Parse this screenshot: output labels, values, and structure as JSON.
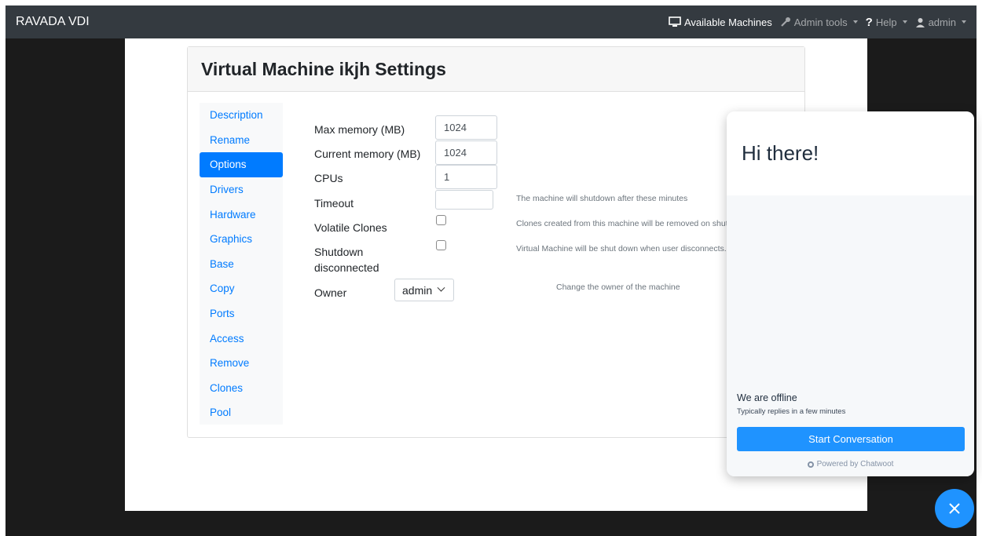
{
  "navbar": {
    "brand": "RAVADA VDI",
    "available_machines": "Available Machines",
    "admin_tools": "Admin tools",
    "help": "Help",
    "user": "admin"
  },
  "card": {
    "title_prefix": "Virtual Machine",
    "vm_name": "ikjh",
    "title_suffix": "Settings"
  },
  "sidebar": {
    "items": [
      {
        "label": "Description"
      },
      {
        "label": "Rename"
      },
      {
        "label": "Options"
      },
      {
        "label": "Drivers"
      },
      {
        "label": "Hardware"
      },
      {
        "label": "Graphics"
      },
      {
        "label": "Base"
      },
      {
        "label": "Copy"
      },
      {
        "label": "Ports"
      },
      {
        "label": "Access"
      },
      {
        "label": "Remove"
      },
      {
        "label": "Clones"
      },
      {
        "label": "Pool"
      }
    ],
    "active": "Options"
  },
  "options": {
    "max_memory_label": "Max memory (MB)",
    "max_memory_value": "1024",
    "current_memory_label": "Current memory (MB)",
    "current_memory_value": "1024",
    "cpus_label": "CPUs",
    "cpus_value": "1",
    "timeout_label": "Timeout",
    "timeout_value": "",
    "timeout_help": "The machine will shutdown after these minutes",
    "volatile_label": "Volatile Clones",
    "volatile_help": "Clones created from this machine will be removed on shutdo",
    "shutdown_label_1": "Shutdown",
    "shutdown_label_2": "disconnected",
    "shutdown_help": "Virtual Machine will be shut down when user disconnects.",
    "owner_label": "Owner",
    "owner_value": "admin",
    "owner_help": "Change the owner of the machine"
  },
  "chat": {
    "greeting": "Hi there!",
    "status": "We are offline",
    "replies": "Typically replies in a few minutes",
    "start_button": "Start Conversation",
    "powered_by": "Powered by Chatwoot"
  },
  "colors": {
    "navbar": "#343a40",
    "link": "#007bff",
    "chat_accent": "#1f93ff"
  }
}
